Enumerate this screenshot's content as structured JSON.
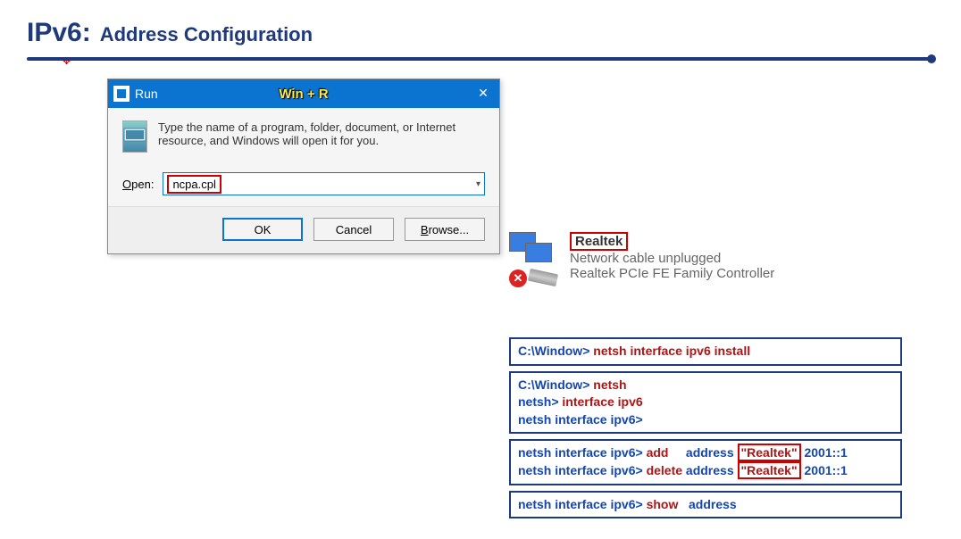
{
  "title": {
    "main": "IPv6:",
    "sub": "Address Configuration"
  },
  "run": {
    "label": "Run",
    "shortcut": "Win + R",
    "close": "✕",
    "desc": "Type the name of a program, folder, document, or Internet resource, and Windows will open it for you.",
    "open_label_pre": "O",
    "open_label_rest": "pen:",
    "value": "ncpa.cpl",
    "ok": "OK",
    "cancel": "Cancel",
    "browse_pre": "B",
    "browse_rest": "rowse..."
  },
  "adapter": {
    "name": "Realtek",
    "status": "Network cable unplugged",
    "device": "Realtek PCIe FE Family Controller"
  },
  "cmd1": {
    "p1": "C:\\Window> ",
    "p2": "netsh  interface  ipv6  install"
  },
  "cmd2": {
    "l1a": "C:\\Window> ",
    "l1b": "netsh",
    "l2a": "netsh> ",
    "l2b": "interface ipv6",
    "l3": "netsh interface ipv6>"
  },
  "cmd3": {
    "pre": "netsh interface ipv6> ",
    "add": "add",
    "delete": "delete",
    "mid": "address",
    "mid2": "address",
    "name": "\"Realtek\"",
    "addr": "2001::1"
  },
  "cmd4": {
    "pre": "netsh interface ipv6> ",
    "show": "show",
    "addr": "address"
  }
}
